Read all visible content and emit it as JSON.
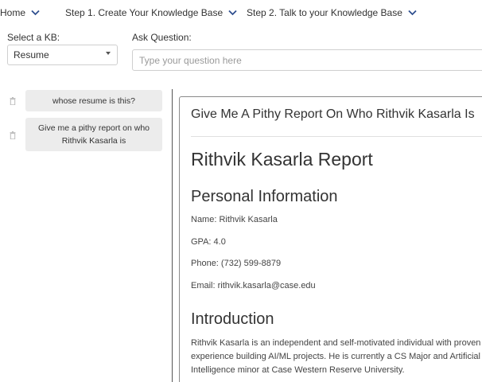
{
  "nav": {
    "home": "Home",
    "step1": "Step 1. Create Your Knowledge Base",
    "step2": "Step 2. Talk to your Knowledge Base"
  },
  "form": {
    "kb_label": "Select a KB:",
    "kb_value": "Resume",
    "question_label": "Ask Question:",
    "question_placeholder": "Type your question here"
  },
  "history": [
    {
      "text": "whose resume is this?"
    },
    {
      "text": "Give me a pithy report on who Rithvik Kasarla is"
    }
  ],
  "report": {
    "title": "Give Me A Pithy Report On Who Rithvik Kasarla Is",
    "heading": "Rithvik Kasarla Report",
    "section_personal": "Personal Information",
    "name": "Name: Rithvik Kasarla",
    "gpa": "GPA: 4.0",
    "phone": "Phone: (732) 599-8879",
    "email": "Email: rithvik.kasarla@case.edu",
    "section_intro": "Introduction",
    "intro_text": "Rithvik Kasarla is an independent and self-motivated individual with proven experience building AI/ML projects. He is currently a CS Major and Artificial Intelligence minor at Case Western Reserve University."
  },
  "colors": {
    "chevron": "#2f4f8f",
    "history_bg": "#ececec",
    "panel_border": "#8a8a8a"
  }
}
